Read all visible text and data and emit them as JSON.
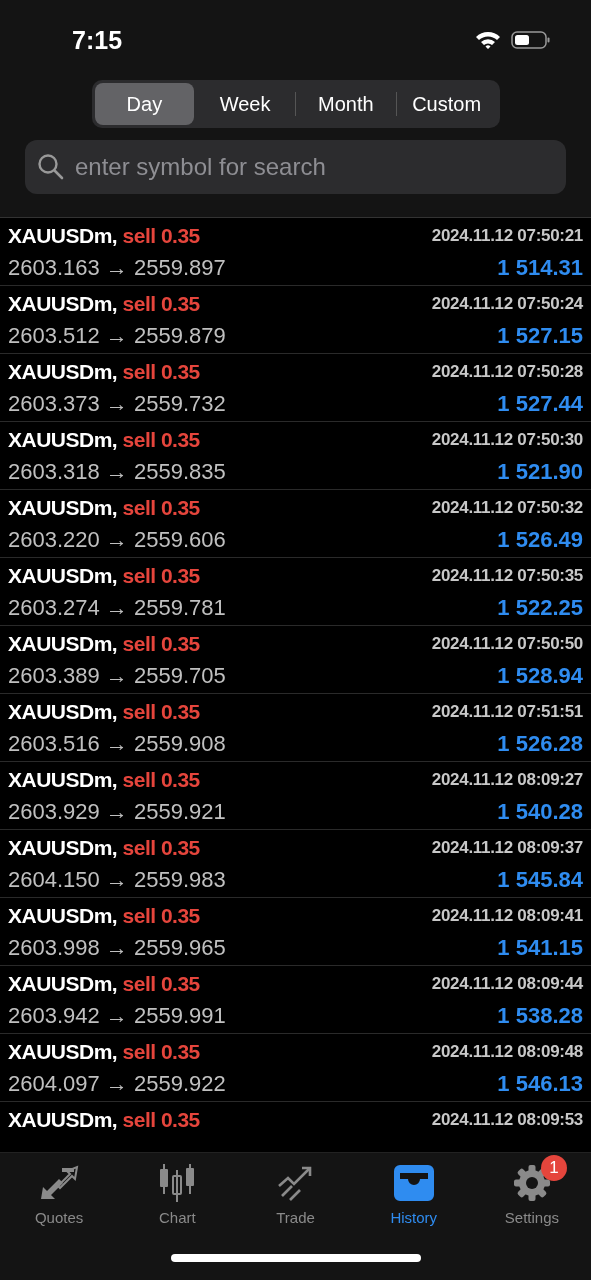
{
  "status_bar": {
    "time": "7:15"
  },
  "period_tabs": [
    {
      "label": "Day",
      "selected": true
    },
    {
      "label": "Week",
      "selected": false
    },
    {
      "label": "Month",
      "selected": false
    },
    {
      "label": "Custom",
      "selected": false
    }
  ],
  "search": {
    "placeholder": "enter symbol for search"
  },
  "deals": [
    {
      "symbol": "XAUUSDm,",
      "kind": "sell",
      "side": "sell 0.35",
      "time": "2024.11.12 07:50:21",
      "prices": "2603.163 → 2559.897",
      "profit": "1 514.31"
    },
    {
      "symbol": "XAUUSDm,",
      "kind": "sell",
      "side": "sell 0.35",
      "time": "2024.11.12 07:50:24",
      "prices": "2603.512 → 2559.879",
      "profit": "1 527.15"
    },
    {
      "symbol": "XAUUSDm,",
      "kind": "sell",
      "side": "sell 0.35",
      "time": "2024.11.12 07:50:28",
      "prices": "2603.373 → 2559.732",
      "profit": "1 527.44"
    },
    {
      "symbol": "XAUUSDm,",
      "kind": "sell",
      "side": "sell 0.35",
      "time": "2024.11.12 07:50:30",
      "prices": "2603.318 → 2559.835",
      "profit": "1 521.90"
    },
    {
      "symbol": "XAUUSDm,",
      "kind": "sell",
      "side": "sell 0.35",
      "time": "2024.11.12 07:50:32",
      "prices": "2603.220 → 2559.606",
      "profit": "1 526.49"
    },
    {
      "symbol": "XAUUSDm,",
      "kind": "sell",
      "side": "sell 0.35",
      "time": "2024.11.12 07:50:35",
      "prices": "2603.274 → 2559.781",
      "profit": "1 522.25"
    },
    {
      "symbol": "XAUUSDm,",
      "kind": "sell",
      "side": "sell 0.35",
      "time": "2024.11.12 07:50:50",
      "prices": "2603.389 → 2559.705",
      "profit": "1 528.94"
    },
    {
      "symbol": "XAUUSDm,",
      "kind": "sell",
      "side": "sell 0.35",
      "time": "2024.11.12 07:51:51",
      "prices": "2603.516 → 2559.908",
      "profit": "1 526.28"
    },
    {
      "symbol": "XAUUSDm,",
      "kind": "sell",
      "side": "sell 0.35",
      "time": "2024.11.12 08:09:27",
      "prices": "2603.929 → 2559.921",
      "profit": "1 540.28"
    },
    {
      "symbol": "XAUUSDm,",
      "kind": "sell",
      "side": "sell 0.35",
      "time": "2024.11.12 08:09:37",
      "prices": "2604.150 → 2559.983",
      "profit": "1 545.84"
    },
    {
      "symbol": "XAUUSDm,",
      "kind": "sell",
      "side": "sell 0.35",
      "time": "2024.11.12 08:09:41",
      "prices": "2603.998 → 2559.965",
      "profit": "1 541.15"
    },
    {
      "symbol": "XAUUSDm,",
      "kind": "sell",
      "side": "sell 0.35",
      "time": "2024.11.12 08:09:44",
      "prices": "2603.942 → 2559.991",
      "profit": "1 538.28"
    },
    {
      "symbol": "XAUUSDm,",
      "kind": "sell",
      "side": "sell 0.35",
      "time": "2024.11.12 08:09:48",
      "prices": "2604.097 → 2559.922",
      "profit": "1 546.13"
    },
    {
      "symbol": "XAUUSDm,",
      "kind": "sell",
      "side": "sell 0.35",
      "time": "2024.11.12 08:09:53"
    }
  ],
  "tab_bar": [
    {
      "kind": "quotes",
      "label": "Quotes",
      "selected": false
    },
    {
      "kind": "chart",
      "label": "Chart",
      "selected": false
    },
    {
      "kind": "trade",
      "label": "Trade",
      "selected": false
    },
    {
      "kind": "history",
      "label": "History",
      "selected": true
    },
    {
      "kind": "settings",
      "label": "Settings",
      "selected": false,
      "badge": "1"
    }
  ]
}
